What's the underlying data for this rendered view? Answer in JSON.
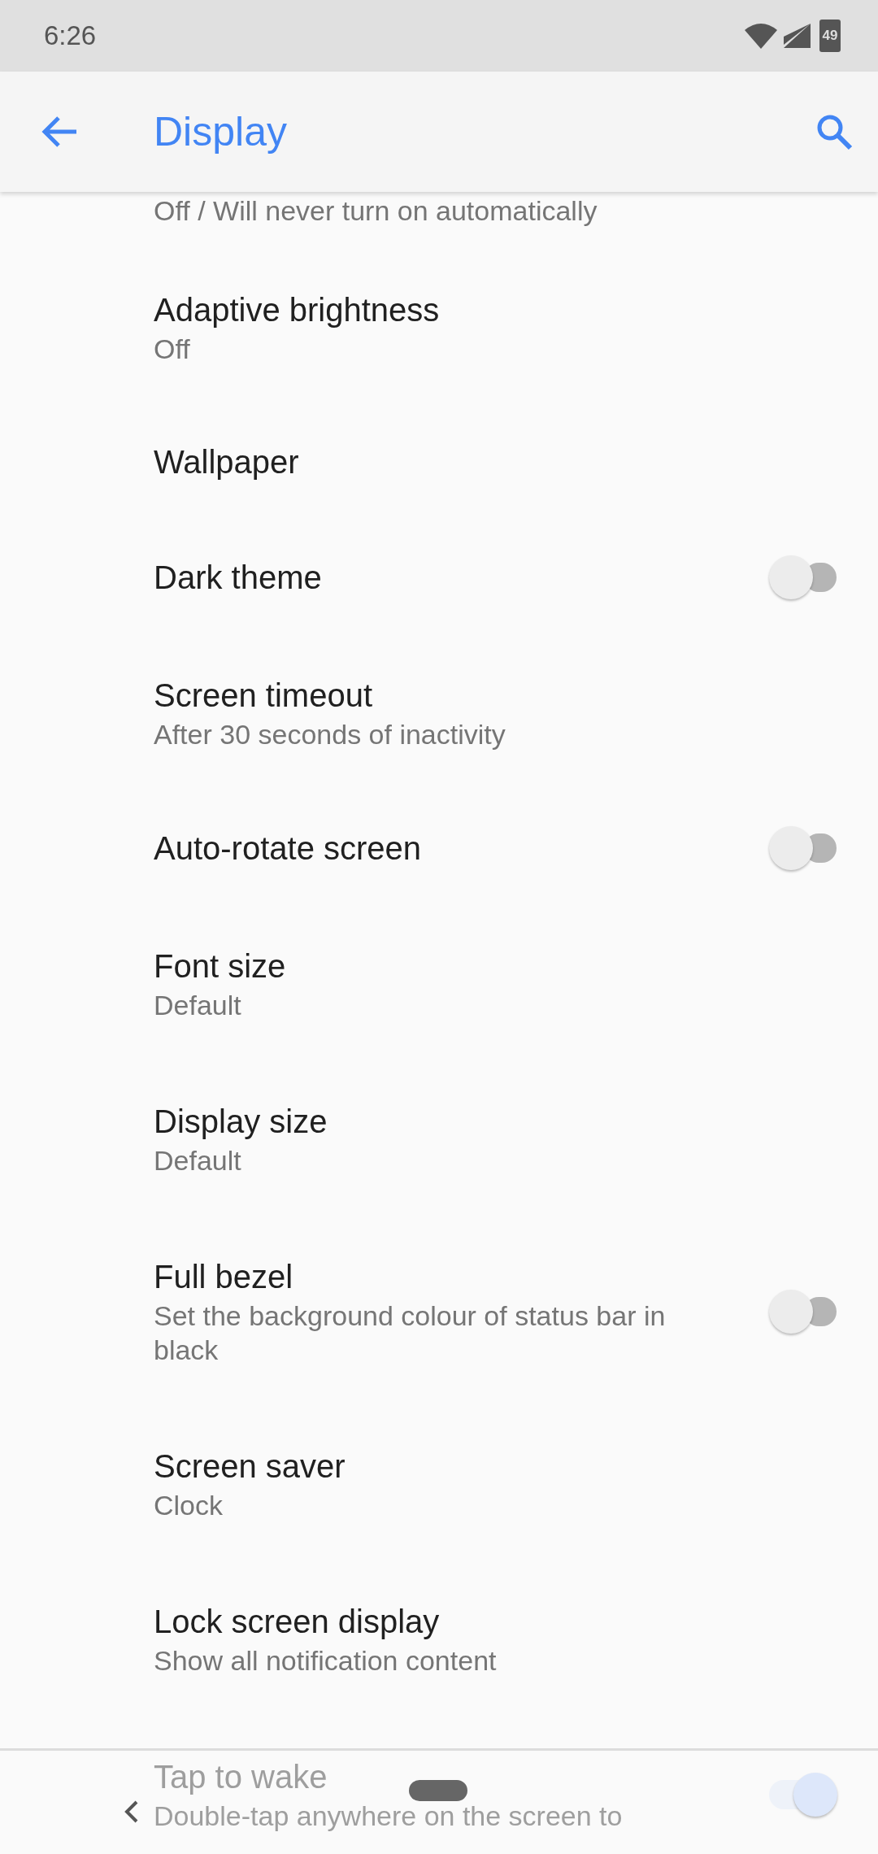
{
  "status_bar": {
    "time": "6:26",
    "battery": "49"
  },
  "app_bar": {
    "title": "Display"
  },
  "settings": [
    {
      "kind": "text",
      "summary": "Off / Will never turn on automatically"
    },
    {
      "kind": "text",
      "title": "Adaptive brightness",
      "summary": "Off"
    },
    {
      "kind": "text",
      "title": "Wallpaper"
    },
    {
      "kind": "switch",
      "title": "Dark theme",
      "on": false
    },
    {
      "kind": "text",
      "title": "Screen timeout",
      "summary": "After 30 seconds of inactivity"
    },
    {
      "kind": "switch",
      "title": "Auto-rotate screen",
      "on": false
    },
    {
      "kind": "text",
      "title": "Font size",
      "summary": "Default"
    },
    {
      "kind": "text",
      "title": "Display size",
      "summary": "Default"
    },
    {
      "kind": "switch",
      "title": "Full bezel",
      "summary": "Set the background colour of status bar in black",
      "on": false
    },
    {
      "kind": "text",
      "title": "Screen saver",
      "summary": "Clock"
    },
    {
      "kind": "text",
      "title": "Lock screen display",
      "summary": "Show all notification content"
    },
    {
      "kind": "switch",
      "title": "Tap to wake",
      "summary": "Double-tap anywhere on the screen to",
      "on": true
    }
  ]
}
